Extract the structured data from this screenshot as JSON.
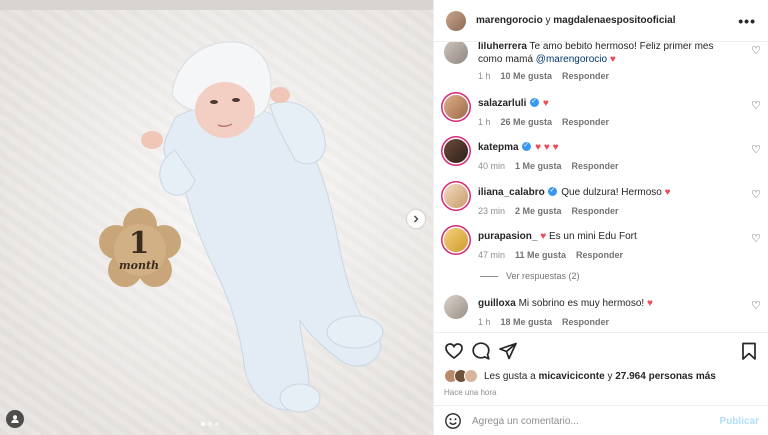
{
  "header": {
    "user1": "marengorocio",
    "conjunction": "y",
    "user2": "magdalenaespositooficial"
  },
  "photo": {
    "milestone_number": "1",
    "milestone_text": "month"
  },
  "comments": [
    {
      "user": "liluherrera",
      "verified": false,
      "text_before": "Te amo bebito hermoso! Feliz primer mes como mamá",
      "mention": "@marengorocio",
      "emoji": "♥",
      "time": "1 h",
      "likes": "10 Me gusta",
      "reply": "Responder"
    },
    {
      "user": "salazarluli",
      "verified": true,
      "text_before": "",
      "mention": "",
      "emoji": "♥",
      "time": "1 h",
      "likes": "26 Me gusta",
      "reply": "Responder"
    },
    {
      "user": "katepma",
      "verified": true,
      "text_before": "",
      "mention": "",
      "emoji": "♥ ♥ ♥",
      "time": "40 min",
      "likes": "1 Me gusta",
      "reply": "Responder"
    },
    {
      "user": "iliana_calabro",
      "verified": true,
      "text_before": "Que dulzura! Hermoso",
      "mention": "",
      "emoji": "♥",
      "time": "23 min",
      "likes": "2 Me gusta",
      "reply": "Responder"
    },
    {
      "user": "purapasion_",
      "verified": false,
      "text_before": "Es un mini Edu Fort",
      "mention": "",
      "emoji": "♥",
      "time": "47 min",
      "likes": "11 Me gusta",
      "reply": "Responder"
    },
    {
      "user": "guilloxa",
      "verified": false,
      "text_before": "Mi sobrino es muy hermoso!",
      "mention": "",
      "emoji": "♥",
      "time": "1 h",
      "likes": "18 Me gusta",
      "reply": "Responder"
    }
  ],
  "view_replies": "Ver respuestas (2)",
  "likes_summary": {
    "prefix": "Les gusta a",
    "user": "micaviciconte",
    "middle": "y",
    "count": "27.964 personas más"
  },
  "posted_time": "Hace una hora",
  "composer": {
    "placeholder": "Agrega un comentario...",
    "post_label": "Publicar"
  }
}
